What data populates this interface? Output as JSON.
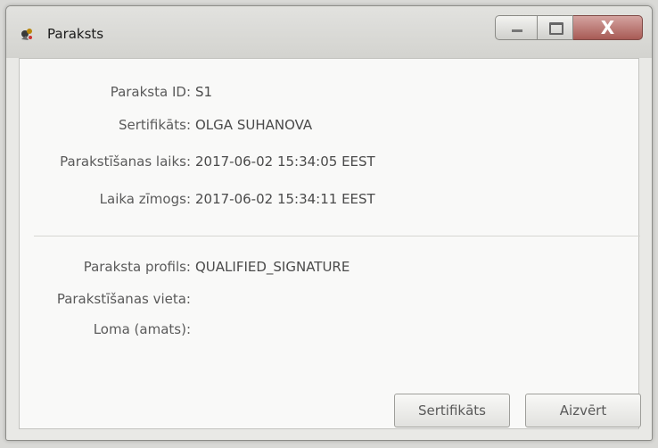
{
  "window": {
    "title": "Paraksts",
    "close_glyph": "X"
  },
  "details": [
    {
      "label": "Paraksta ID:",
      "value": "S1"
    },
    {
      "label": "Sertifikāts:",
      "value": "OLGA SUHANOVA"
    },
    {
      "label": "Parakstīšanas laiks:",
      "value": "2017-06-02 15:34:05 EEST"
    },
    {
      "label": "Laika zīmogs:",
      "value": "2017-06-02 15:34:11 EEST"
    }
  ],
  "profile": [
    {
      "label": "Paraksta profils:",
      "value": "QUALIFIED_SIGNATURE"
    },
    {
      "label": "Parakstīšanas vieta:",
      "value": ""
    },
    {
      "label": "Loma (amats):",
      "value": ""
    }
  ],
  "buttons": {
    "certificate": "Sertifikāts",
    "close": "Aizvērt"
  }
}
